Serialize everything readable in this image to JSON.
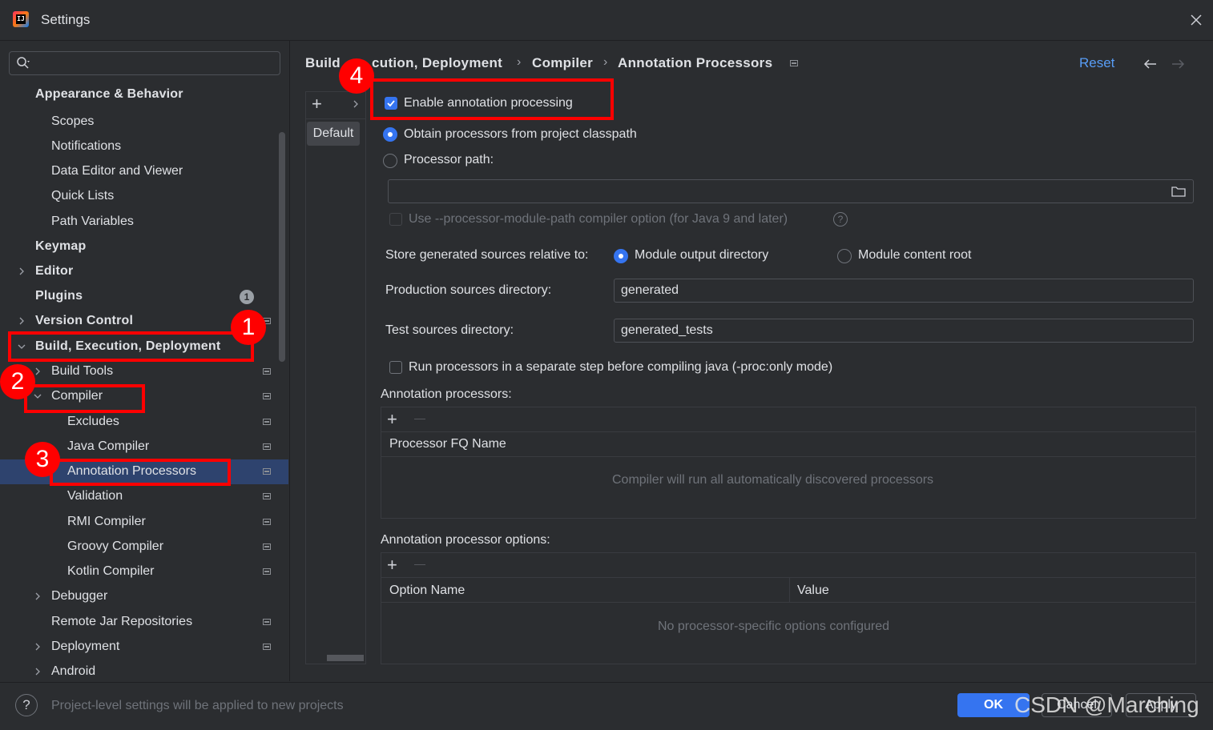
{
  "window": {
    "title": "Settings"
  },
  "search": {
    "placeholder": ""
  },
  "tree": {
    "appearance": "Appearance & Behavior",
    "scopes": "Scopes",
    "notifications": "Notifications",
    "data_editor": "Data Editor and Viewer",
    "quick_lists": "Quick Lists",
    "path_variables": "Path Variables",
    "keymap": "Keymap",
    "editor": "Editor",
    "plugins": "Plugins",
    "plugins_badge": "1",
    "version_control": "Version Control",
    "build": "Build, Execution, Deployment",
    "build_tools": "Build Tools",
    "compiler": "Compiler",
    "excludes": "Excludes",
    "java_compiler": "Java Compiler",
    "annotation_processors": "Annotation Processors",
    "validation": "Validation",
    "rmi_compiler": "RMI Compiler",
    "groovy_compiler": "Groovy Compiler",
    "kotlin_compiler": "Kotlin Compiler",
    "debugger": "Debugger",
    "remote_jar": "Remote Jar Repositories",
    "deployment": "Deployment",
    "android": "Android"
  },
  "breadcrumb": {
    "part1": "Build",
    "part1b": "cution, Deployment",
    "part2": "Compiler",
    "part3": "Annotation Processors",
    "separator": "›"
  },
  "header": {
    "reset": "Reset"
  },
  "profiles": {
    "default": "Default"
  },
  "form": {
    "enable_processing": "Enable annotation processing",
    "obtain_classpath": "Obtain processors from project classpath",
    "processor_path": "Processor path:",
    "processor_path_value": "",
    "use_module_path": "Use --processor-module-path compiler option (for Java 9 and later)",
    "store_generated": "Store generated sources relative to:",
    "module_output": "Module output directory",
    "module_content": "Module content root",
    "production_label": "Production sources directory:",
    "production_value": "generated",
    "test_label": "Test sources directory:",
    "test_value": "generated_tests",
    "run_separate": "Run processors in a separate step before compiling java (-proc:only mode)"
  },
  "processors_table": {
    "title": "Annotation processors:",
    "column": "Processor FQ Name",
    "empty": "Compiler will run all automatically discovered processors"
  },
  "options_table": {
    "title": "Annotation processor options:",
    "col_name": "Option Name",
    "col_value": "Value",
    "empty": "No processor-specific options configured"
  },
  "footer": {
    "hint": "Project-level settings will be applied to new projects",
    "ok": "OK",
    "cancel": "Cancel",
    "apply": "Apply"
  },
  "annotations": {
    "n1": "1",
    "n2": "2",
    "n3": "3",
    "n4": "4"
  },
  "watermark": "CSDN @Marching",
  "colors": {
    "accent": "#3574f0",
    "selection": "#2e436e",
    "annotation": "#ff0000",
    "link": "#589df6"
  },
  "icons": {
    "app": "intellij-logo",
    "close": "close-icon",
    "search": "search-icon",
    "folder": "folder-icon",
    "help": "question-icon"
  }
}
